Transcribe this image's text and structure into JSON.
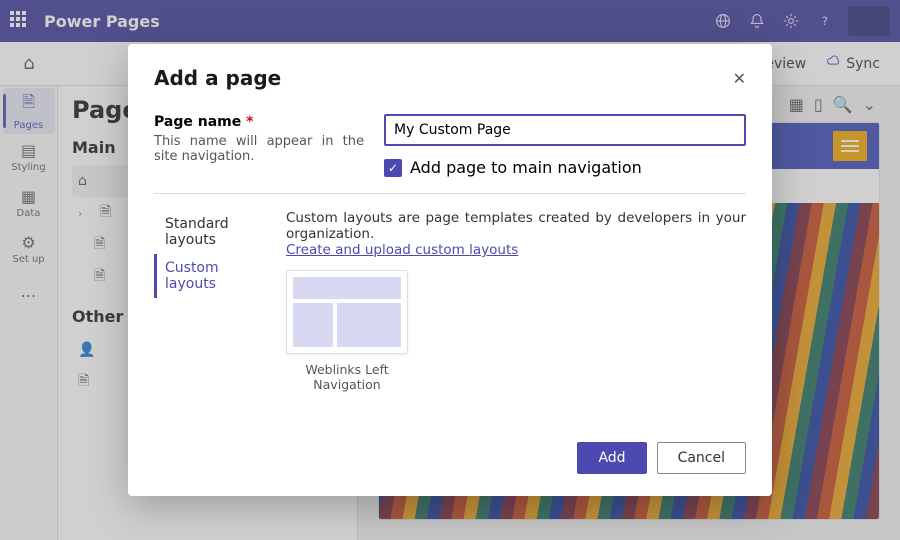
{
  "app": {
    "name": "Power Pages"
  },
  "topbar": {
    "icons": [
      "globe-icon",
      "bell-icon",
      "gear-icon",
      "help-icon",
      "account-icon"
    ]
  },
  "cmdbar": {
    "home_icon": "home",
    "preview_label": "eview",
    "sync_label": "Sync"
  },
  "rail": {
    "items": [
      {
        "label": "Pages",
        "icon": "page",
        "selected": true
      },
      {
        "label": "Styling",
        "icon": "brush",
        "selected": false
      },
      {
        "label": "Data",
        "icon": "table",
        "selected": false
      },
      {
        "label": "Set up",
        "icon": "gear-page",
        "selected": false
      },
      {
        "label": "",
        "icon": "more",
        "selected": false
      }
    ]
  },
  "pages_panel": {
    "title": "Page",
    "main_heading": "Main",
    "other_heading": "Other",
    "tree": [
      {
        "icon": "home",
        "label": "",
        "active": true,
        "indent": 0
      },
      {
        "icon": "page",
        "label": "",
        "caret": true,
        "indent": 0
      },
      {
        "icon": "page",
        "label": "",
        "indent": 1
      },
      {
        "icon": "page",
        "label": "",
        "indent": 1
      }
    ],
    "other": [
      {
        "icon": "person",
        "label": ""
      },
      {
        "icon": "page-add",
        "label": ""
      }
    ]
  },
  "canvas": {
    "toolbar_icons": [
      "grid",
      "align",
      "zoom"
    ],
    "zoom_caret": "⌄"
  },
  "modal": {
    "title": "Add a page",
    "page_name_label": "Page name",
    "page_name_help": "This name will appear in the site navigation.",
    "page_name_value": "My Custom Page",
    "add_to_nav_label": "Add page to main navigation",
    "add_to_nav_checked": true,
    "tab_standard": "Standard layouts",
    "tab_custom": "Custom layouts",
    "custom_desc": "Custom layouts are page templates created by developers in your organization.",
    "custom_link": "Create and upload custom layouts",
    "template_name": "Weblinks Left Navigation",
    "primary_btn": "Add",
    "secondary_btn": "Cancel"
  }
}
